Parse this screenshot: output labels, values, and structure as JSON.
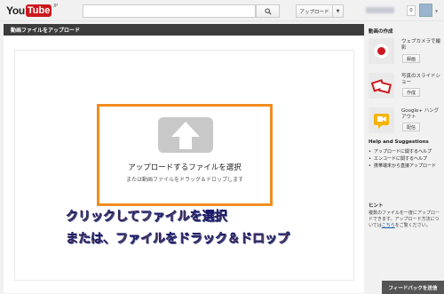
{
  "header": {
    "logo_you": "You",
    "logo_tube": "Tube",
    "logo_region": "JP",
    "search_placeholder": "",
    "upload_label": "アップロード",
    "notifications_count": "0"
  },
  "main": {
    "title": "動画ファイルをアップロード",
    "upload_text": "アップロードするファイルを選択",
    "upload_subtext": "または動画ファイルをドラッグ＆ドロップします",
    "annotation_line1": "クリックしてファイルを選択",
    "annotation_line2": "または、ファイルをドラック＆ドロップ"
  },
  "sidebar": {
    "create_title": "動画の作成",
    "items": [
      {
        "label": "ウェブカメラで撮影",
        "button": "録画",
        "icon": "webcam-record-icon"
      },
      {
        "label": "写真のスライドショー",
        "button": "作成",
        "icon": "photo-slideshow-icon"
      },
      {
        "label": "Google+ ハングアウト",
        "button": "配信",
        "icon": "hangout-icon"
      }
    ],
    "help_title": "Help and Suggestions",
    "help_links": [
      "アップロードに関するヘルプ",
      "エンコードに関するヘルプ",
      "携帯端末から直接アップロード"
    ],
    "hint_title": "ヒント",
    "hint_text": "複数のファイルを一度にアップロードできます。アップロード方法については",
    "hint_link": "こちら",
    "hint_suffix": "をご覧ください。"
  },
  "feedback_label": "フィードバックを送信",
  "colors": {
    "accent_orange": "#f28c1f",
    "youtube_red": "#cc181e",
    "panel_header": "#3c3c3c"
  }
}
